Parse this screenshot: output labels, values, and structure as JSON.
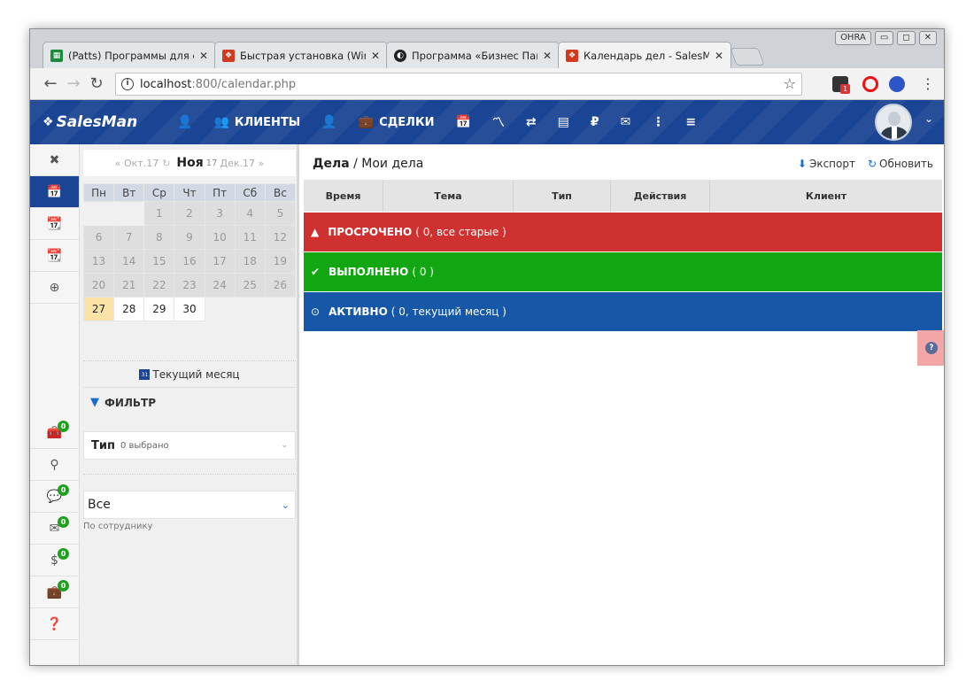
{
  "browser": {
    "tabs": [
      {
        "title": "(Patts) Программы для с",
        "favicon_color": "#1b8a3a"
      },
      {
        "title": "Быстрая установка (Win",
        "favicon_color": "#d03a1f"
      },
      {
        "title": "Программа «Бизнес Пак",
        "favicon_color": "#222222"
      },
      {
        "title": "Календарь дел - SalesM",
        "favicon_color": "#d03a1f"
      }
    ],
    "close_glyph": "✕",
    "url_host": "localhost",
    "url_path": ":800/calendar.php",
    "window_label": "OHRA",
    "ext_badge": "1"
  },
  "app": {
    "logo": "SalesMan",
    "nav": [
      {
        "label": "",
        "icon": "add-user-icon",
        "glyph": "👤"
      },
      {
        "label": "КЛИЕНТЫ",
        "icon": "clients-icon",
        "glyph": "👥"
      },
      {
        "label": "",
        "icon": "contact-icon",
        "glyph": "👤"
      },
      {
        "label": "СДЕЛКИ",
        "icon": "briefcase-icon",
        "glyph": "💼"
      },
      {
        "label": "",
        "icon": "calendar-icon",
        "glyph": "📅"
      },
      {
        "label": "",
        "icon": "stats-icon",
        "glyph": "〽"
      },
      {
        "label": "",
        "icon": "shuffle-icon",
        "glyph": "⇄"
      },
      {
        "label": "",
        "icon": "inbox-icon",
        "glyph": "▤"
      },
      {
        "label": "",
        "icon": "ruble-icon",
        "glyph": "₽"
      },
      {
        "label": "",
        "icon": "mail-icon",
        "glyph": "✉"
      },
      {
        "label": "",
        "icon": "more-icon",
        "glyph": "⋮"
      },
      {
        "label": "",
        "icon": "menu-icon",
        "glyph": "≡"
      }
    ],
    "accent": "#1a4494"
  },
  "sidebar_badges": {
    "count": "0"
  },
  "calendar": {
    "prev": "« Окт.17",
    "current": "Ноя",
    "year": "17",
    "next": "Дек.17 »",
    "weekdays": [
      "Пн",
      "Вт",
      "Ср",
      "Чт",
      "Пт",
      "Сб",
      "Вс"
    ],
    "weeks": [
      [
        "",
        "",
        "1",
        "2",
        "3",
        "4",
        "5"
      ],
      [
        "6",
        "7",
        "8",
        "9",
        "10",
        "11",
        "12"
      ],
      [
        "13",
        "14",
        "15",
        "16",
        "17",
        "18",
        "19"
      ],
      [
        "20",
        "21",
        "22",
        "23",
        "24",
        "25",
        "26"
      ],
      [
        "27",
        "28",
        "29",
        "30",
        "",
        "",
        ""
      ]
    ],
    "today": "27",
    "current_month_label": "Текущий месяц"
  },
  "filter": {
    "title": "ФИЛЬТР",
    "type_label": "Тип",
    "type_count": "0 выбрано",
    "employee_value": "Все",
    "employee_label": "По сотруднику"
  },
  "main": {
    "breadcrumb_main": "Дела",
    "breadcrumb_sub": " / Мои дела",
    "export": "Экспорт",
    "refresh": "Обновить",
    "columns": [
      "Время",
      "Тема",
      "Тип",
      "Действия",
      "Клиент"
    ],
    "groups": [
      {
        "title": "ПРОСРОЧЕНО",
        "note": "( 0, все старые )",
        "color": "#cf3030",
        "glyph": "▲"
      },
      {
        "title": "ВЫПОЛНЕНО",
        "note": "( 0 )",
        "color": "#12a612",
        "glyph": "✔"
      },
      {
        "title": "АКТИВНО",
        "note": "( 0, текущий месяц )",
        "color": "#1657a8",
        "glyph": "⊙"
      }
    ]
  }
}
